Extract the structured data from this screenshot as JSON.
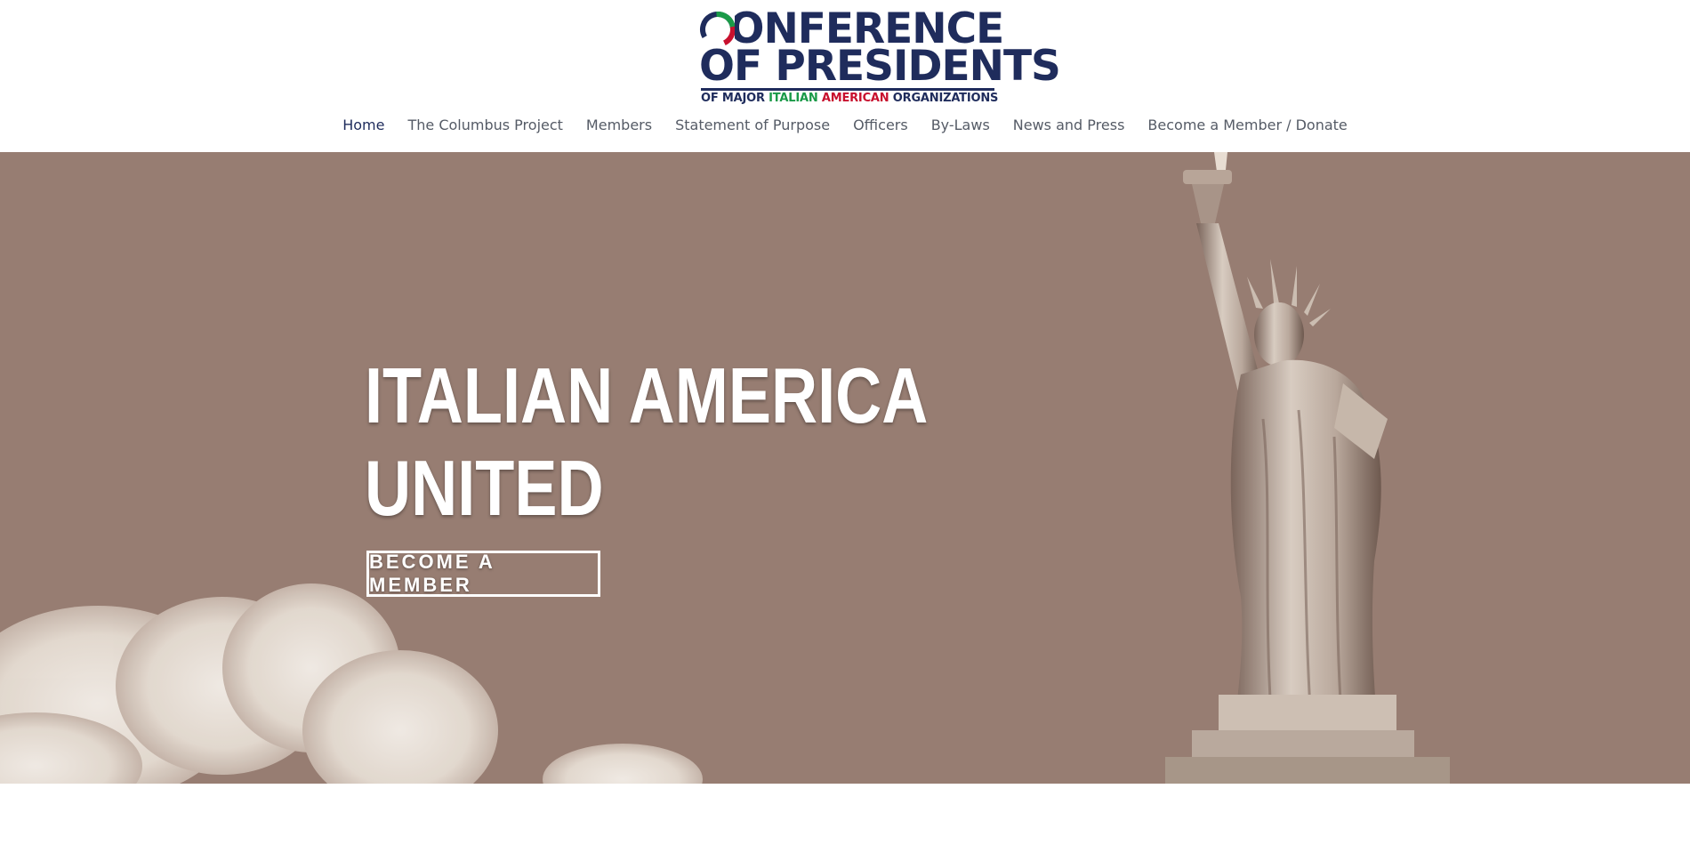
{
  "header": {
    "logo": {
      "line1": "CONFERENCE",
      "line2": "OF PRESIDENTS",
      "sub_prefix": "OF MAJOR ",
      "sub_italian": "ITALIAN",
      "sub_space1": " ",
      "sub_american": "AMERICAN",
      "sub_suffix": " ORGANIZATIONS",
      "colors": {
        "navy": "#1f2c5c",
        "green": "#1a9a48",
        "red": "#c8102e"
      }
    },
    "nav": [
      {
        "label": "Home",
        "active": true
      },
      {
        "label": "The Columbus Project"
      },
      {
        "label": "Members"
      },
      {
        "label": "Statement of Purpose"
      },
      {
        "label": "Officers"
      },
      {
        "label": "By-Laws"
      },
      {
        "label": "News and Press"
      },
      {
        "label": "Become a Member / Donate"
      }
    ]
  },
  "hero": {
    "title_line1": "ITALIAN AMERICA",
    "title_line2": "UNITED",
    "button_label": "BECOME A MEMBER",
    "background_color": "#977d72",
    "image_subject": "statue-of-liberty-sepia"
  }
}
